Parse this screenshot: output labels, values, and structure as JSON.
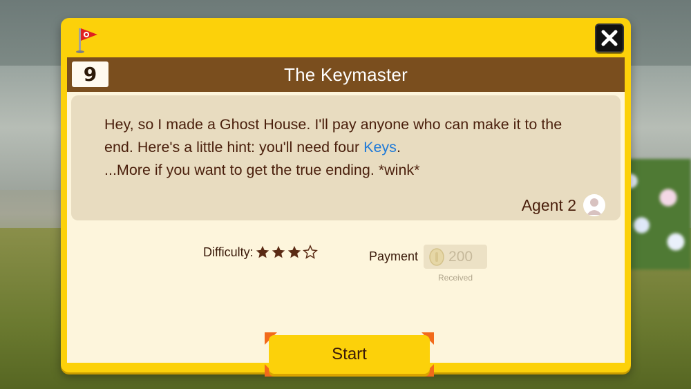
{
  "course": {
    "number": "9",
    "title": "The Keymaster"
  },
  "message": {
    "line1": "Hey, so I made a Ghost House. I'll pay anyone who can make it to the",
    "line2_before": "end. Here's a little hint: you'll need four ",
    "line2_keyword": "Keys",
    "line2_after": ".",
    "line3": "...More if you want to get the true ending. *wink*"
  },
  "author": {
    "name": "Agent 2"
  },
  "difficulty": {
    "label": "Difficulty:",
    "rating": 3,
    "max": 4
  },
  "payment": {
    "label": "Payment",
    "amount": "200",
    "status": "Received"
  },
  "start_button": {
    "label": "Start"
  },
  "icons": {
    "flag": "flag-icon",
    "close": "close-icon",
    "avatar": "user-avatar-icon",
    "coin": "coin-icon",
    "star": "star-icon"
  },
  "colors": {
    "frame": "#fcd10a",
    "title_bar": "#7a4e1e",
    "keyword": "#1f7ad8",
    "text": "#4a1f0c"
  }
}
